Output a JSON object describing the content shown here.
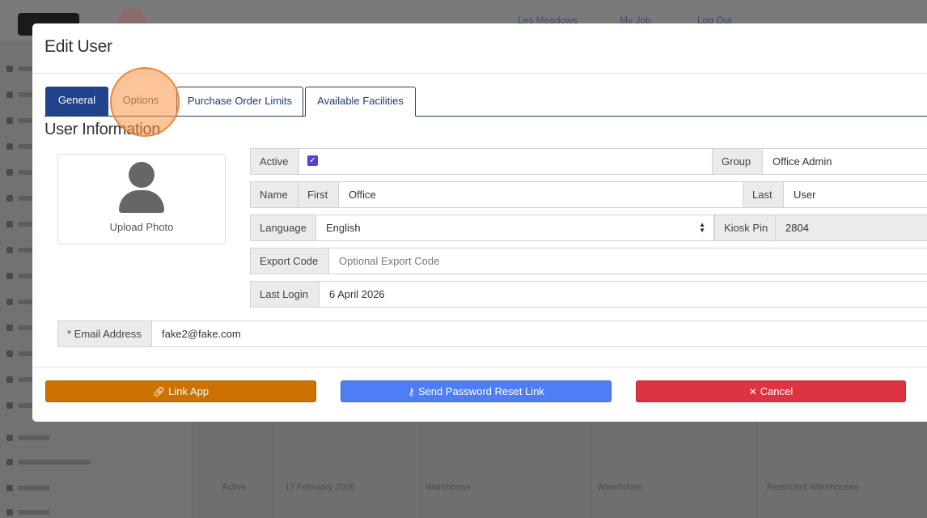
{
  "background": {
    "top_links": [
      "Les Meadows",
      "My Job",
      "Log Out"
    ],
    "table_cells": [
      "Active",
      "17 February 2026",
      "Warehouse",
      "Warehouse",
      "Restricted Warehouses"
    ]
  },
  "modal": {
    "title": "Edit User",
    "tabs": [
      {
        "label": "General",
        "active": true
      },
      {
        "label": "Options",
        "active": false
      },
      {
        "label": "Purchase Order Limits",
        "active": false
      },
      {
        "label": "Available Facilities",
        "active": false
      }
    ],
    "section_title": "User Information",
    "photo": {
      "label": "Upload Photo"
    },
    "fields": {
      "active": {
        "label": "Active",
        "checked": true
      },
      "group": {
        "label": "Group",
        "value": "Office Admin"
      },
      "name": {
        "label": "Name",
        "first_label": "First",
        "first_value": "Office",
        "last_label": "Last",
        "last_value": "User"
      },
      "language": {
        "label": "Language",
        "value": "English"
      },
      "kiosk_pin": {
        "label": "Kiosk Pin",
        "value": "2804"
      },
      "export_code": {
        "label": "Export Code",
        "placeholder": "Optional Export Code"
      },
      "last_login": {
        "label": "Last Login",
        "value": "6 April 2026"
      },
      "email": {
        "label": "* Email Address",
        "value": "fake2@fake.com"
      }
    },
    "buttons": {
      "link_app": "Link App",
      "send_reset": "Send Password Reset Link",
      "cancel": "Cancel"
    }
  },
  "colors": {
    "tab_active": "#21438a",
    "link_app": "#cc7200",
    "send_reset": "#4f7ef4",
    "cancel": "#de3340",
    "click_highlight": "#f79646"
  },
  "icons": {
    "link_app": "link-icon",
    "send_reset": "key-icon",
    "cancel": "close-icon",
    "photo": "user-silhouette-icon",
    "select": "sort-arrows-icon"
  }
}
